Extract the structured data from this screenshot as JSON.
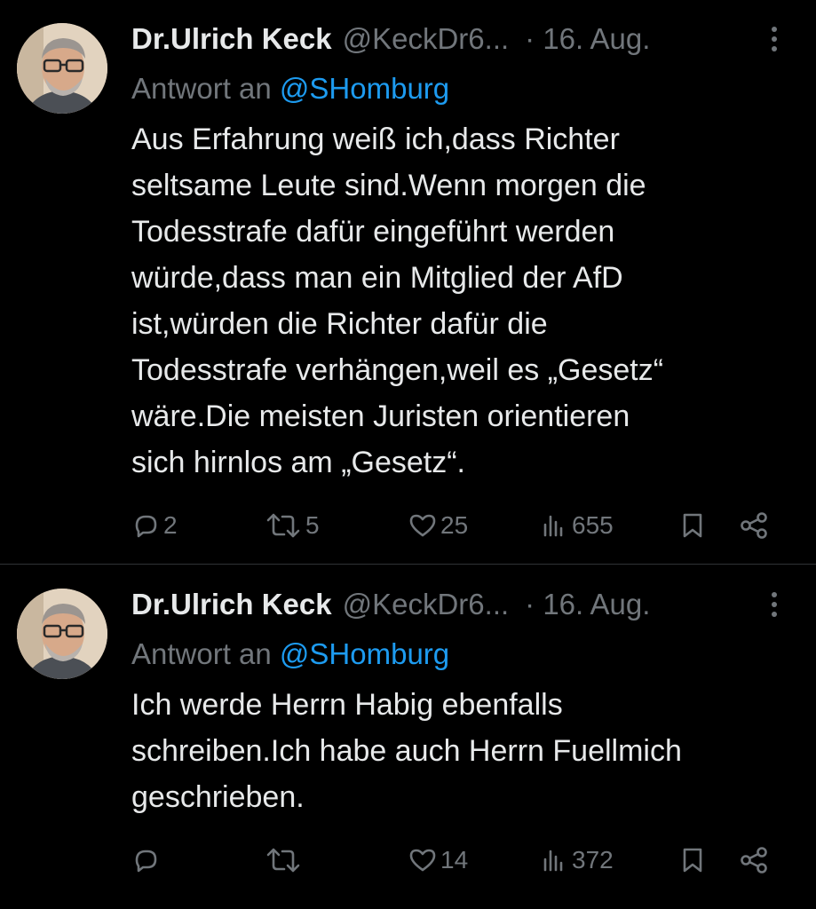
{
  "tweets": [
    {
      "name": "Dr.Ulrich Keck",
      "handle": "@KeckDr6...",
      "date": "· 16. Aug.",
      "reply_prefix": "Antwort an ",
      "reply_to": "@SHomburg",
      "lines": [
        "Aus Erfahrung weiß ich,dass Richter",
        "seltsame Leute sind.Wenn morgen die",
        "Todesstrafe dafür eingeführt werden",
        "würde,dass man ein Mitglied der AfD",
        "ist,würden die Richter dafür die",
        "Todesstrafe verhängen,weil es „Gesetz“",
        "wäre.Die meisten Juristen orientieren",
        "sich hirnlos am „Gesetz“."
      ],
      "replies": "2",
      "reposts": "5",
      "likes": "25",
      "views": "655"
    },
    {
      "name": "Dr.Ulrich Keck",
      "handle": "@KeckDr6...",
      "date": "· 16. Aug.",
      "reply_prefix": "Antwort an ",
      "reply_to": "@SHomburg",
      "lines": [
        "Ich werde Herrn Habig ebenfalls",
        "schreiben.Ich habe auch Herrn Fuellmich",
        "geschrieben."
      ],
      "replies": "",
      "reposts": "",
      "likes": "14",
      "views": "372"
    }
  ],
  "icons": {
    "reply": "reply-icon",
    "repost": "repost-icon",
    "like": "heart-icon",
    "views": "views-icon",
    "bookmark": "bookmark-icon",
    "share": "share-icon",
    "more": "more-icon"
  },
  "colors": {
    "background": "#000000",
    "text": "#e7e9ea",
    "muted": "#71767b",
    "link": "#1d9bf0",
    "divider": "#2f3336"
  }
}
